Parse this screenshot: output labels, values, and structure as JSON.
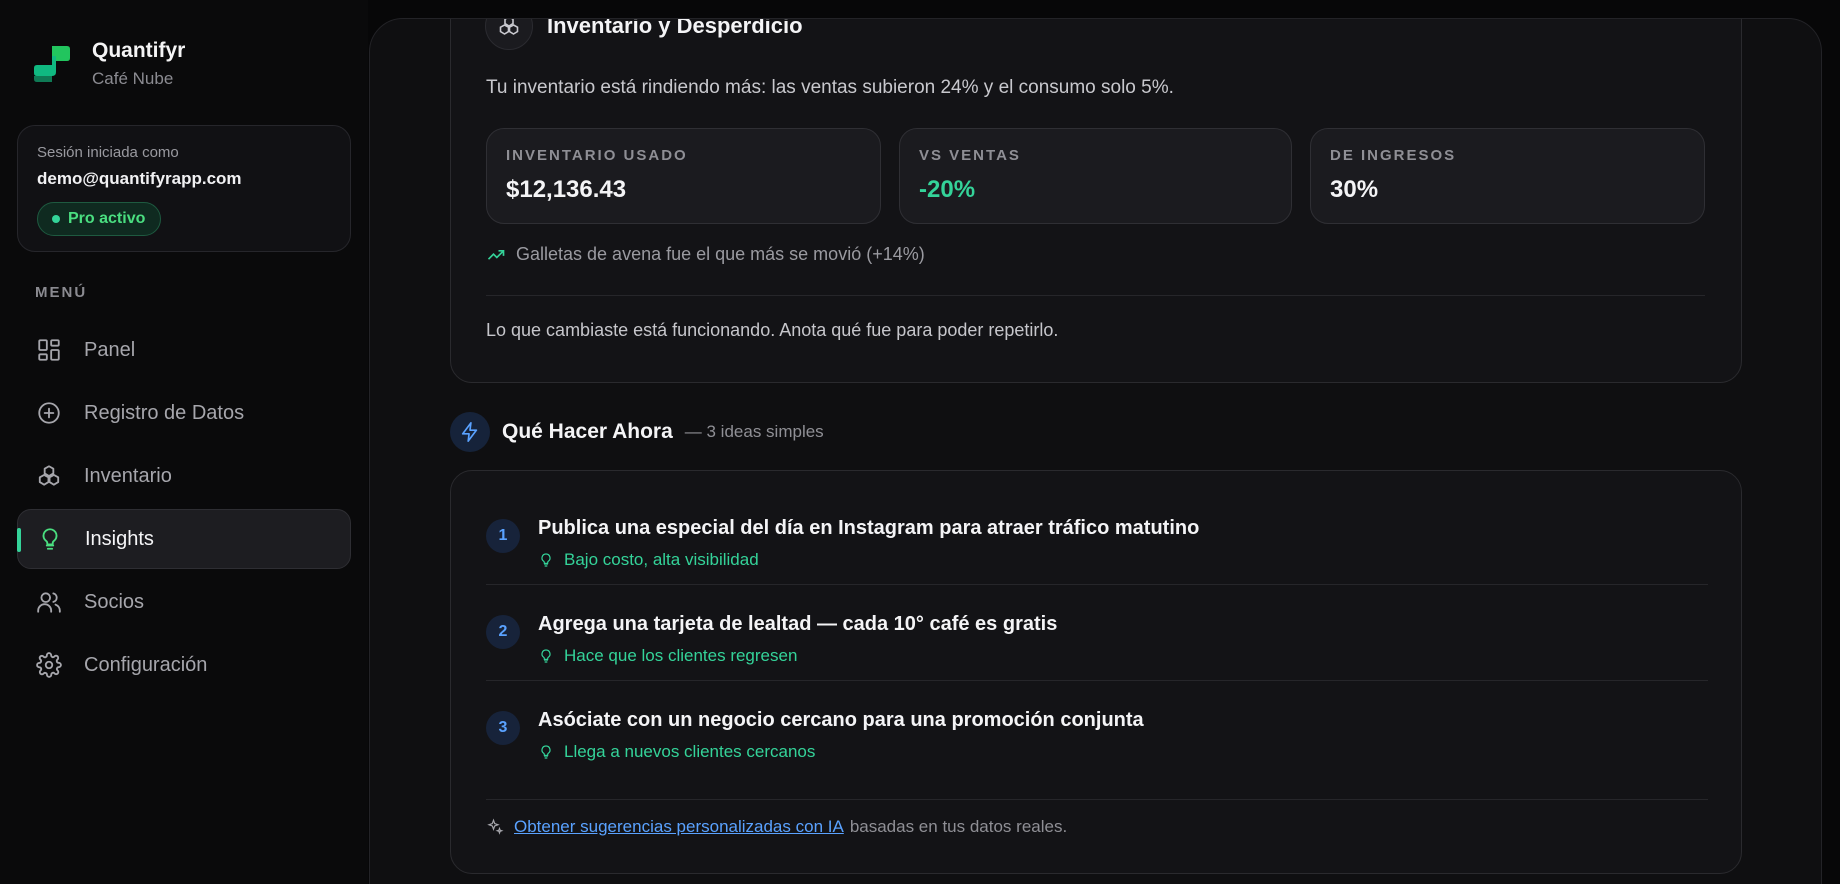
{
  "brand": {
    "name": "Quantifyr",
    "subtitle": "Café Nube"
  },
  "session": {
    "label": "Sesión iniciada como",
    "email": "demo@quantifyrapp.com",
    "badge": "Pro activo"
  },
  "menu": {
    "label": "MENÚ",
    "items": [
      {
        "label": "Panel",
        "icon": "dashboard-icon"
      },
      {
        "label": "Registro de Datos",
        "icon": "plus-circle-icon"
      },
      {
        "label": "Inventario",
        "icon": "boxes-icon"
      },
      {
        "label": "Insights",
        "icon": "lightbulb-icon",
        "active": true
      },
      {
        "label": "Socios",
        "icon": "users-icon"
      },
      {
        "label": "Configuración",
        "icon": "gear-icon"
      }
    ]
  },
  "inventory": {
    "title": "Inventario y Desperdicio",
    "summary": "Tu inventario está rindiendo más: las ventas subieron 24% y el consumo solo 5%.",
    "stats": [
      {
        "label": "INVENTARIO USADO",
        "value": "$12,136.43"
      },
      {
        "label": "VS VENTAS",
        "value": "-20%"
      },
      {
        "label": "DE INGRESOS",
        "value": "30%"
      }
    ],
    "trend": "Galletas de avena fue el que más se movió (+14%)",
    "advice": "Lo que cambiaste está funcionando. Anota qué fue para poder repetirlo."
  },
  "actions": {
    "title": "Qué Hacer Ahora",
    "subtitle": "— 3 ideas simples",
    "ideas": [
      {
        "num": "1",
        "title": "Publica una especial del día en Instagram para atraer tráfico matutino",
        "tip": "Bajo costo, alta visibilidad"
      },
      {
        "num": "2",
        "title": "Agrega una tarjeta de lealtad — cada 10° café es gratis",
        "tip": "Hace que los clientes regresen"
      },
      {
        "num": "3",
        "title": "Asóciate con un negocio cercano para una promoción conjunta",
        "tip": "Llega a nuevos clientes cercanos"
      }
    ],
    "ai_link": "Obtener sugerencias personalizadas con IA",
    "ai_suffix": "basadas en tus datos reales."
  },
  "colors": {
    "accent_green": "#34d399",
    "accent_blue": "#5aa2ff",
    "background": "#070708"
  }
}
